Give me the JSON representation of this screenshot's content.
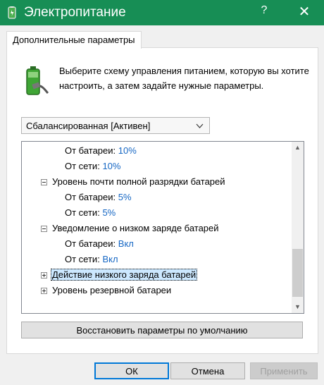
{
  "window": {
    "title": "Электропитание",
    "help_label": "?",
    "close_label": "✕",
    "title_bar_color": "#178e55"
  },
  "tab": {
    "label": "Дополнительные параметры"
  },
  "intro": {
    "text": "Выберите схему управления питанием, которую вы хотите настроить, а затем задайте нужные параметры."
  },
  "scheme_select": {
    "value": "Сбалансированная [Активен]"
  },
  "tree": {
    "rows": [
      {
        "label": "От батареи:",
        "value": "10%"
      },
      {
        "label": "От сети:",
        "value": "10%"
      },
      {
        "label": "Уровень почти полной разрядки батарей",
        "expander": "minus"
      },
      {
        "label": "От батареи:",
        "value": "5%"
      },
      {
        "label": "От сети:",
        "value": "5%"
      },
      {
        "label": "Уведомление о низком заряде батарей",
        "expander": "minus"
      },
      {
        "label": "От батареи:",
        "value": "Вкл"
      },
      {
        "label": "От сети:",
        "value": "Вкл"
      },
      {
        "label": "Действие низкого заряда батарей",
        "expander": "plus",
        "selected": true
      },
      {
        "label": "Уровень резервной батареи",
        "expander": "plus"
      }
    ]
  },
  "buttons": {
    "restore": "Восстановить параметры по умолчанию",
    "ok": "ОК",
    "cancel": "Отмена",
    "apply": "Применить"
  },
  "colors": {
    "value_text": "#1667c4",
    "selection": "#cce8ff",
    "accent": "#0078d7"
  }
}
